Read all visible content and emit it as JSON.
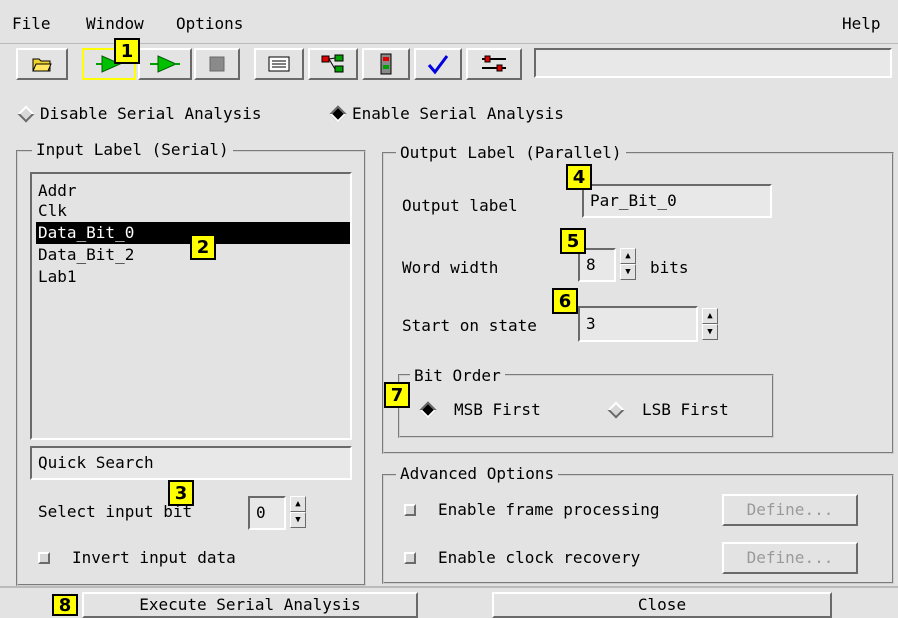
{
  "menu": {
    "file": "File",
    "window": "Window",
    "options": "Options",
    "help": "Help"
  },
  "toolbar": {
    "icons": [
      "open-folder-icon",
      "run-icon",
      "run-repetitive-icon",
      "stop-icon",
      "listing-icon",
      "hierarchy-icon",
      "module-icon",
      "check-icon",
      "settings-icon"
    ],
    "status_text": ""
  },
  "callouts": {
    "c1": "1",
    "c2": "2",
    "c3": "3",
    "c4": "4",
    "c5": "5",
    "c6": "6",
    "c7": "7",
    "c8": "8"
  },
  "mode": {
    "disable_label": "Disable Serial Analysis",
    "enable_label": "Enable Serial Analysis",
    "selected": "enable"
  },
  "input_label": {
    "title": "Input Label (Serial)",
    "items": [
      "Addr",
      "Clk",
      "Data_Bit_0",
      "Data_Bit_2",
      "Lab1"
    ],
    "selected_index": 2,
    "quick_search": "Quick Search",
    "select_input_bit_label": "Select input bit",
    "select_input_bit_value": "0",
    "invert_label": "Invert input data"
  },
  "output_label": {
    "title": "Output Label (Parallel)",
    "output_label_caption": "Output label",
    "output_label_value": "Par_Bit_0",
    "word_width_caption": "Word width",
    "word_width_value": "8",
    "word_width_unit": "bits",
    "start_state_caption": "Start on state",
    "start_state_value": "3"
  },
  "bit_order": {
    "title": "Bit Order",
    "msb_label": "MSB First",
    "lsb_label": "LSB First",
    "selected": "msb"
  },
  "advanced": {
    "title": "Advanced Options",
    "frame_label": "Enable frame processing",
    "clock_label": "Enable clock recovery",
    "define_label": "Define..."
  },
  "buttons": {
    "execute": "Execute Serial Analysis",
    "close": "Close"
  },
  "colors": {
    "callout": "#ffff00",
    "background": "#e3e3e3",
    "selected_row": "#000000",
    "disabled_text": "#9a9a9a"
  }
}
